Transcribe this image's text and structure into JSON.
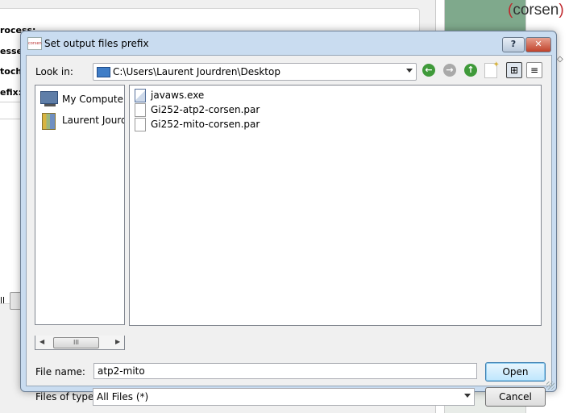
{
  "background": {
    "labels": [
      "rocess:",
      "esse",
      "toch",
      "efix:"
    ],
    "button_text": "ll",
    "logo_open": "(",
    "logo_text": "corsen",
    "logo_close": ")",
    "tiny_text": "◇"
  },
  "dialog": {
    "title": "Set output files prefix",
    "icon_text": "corsen",
    "help_label": "?",
    "close_label": "✕",
    "look_in": {
      "label": "Look in:",
      "value": "C:\\Users\\Laurent Jourdren\\Desktop"
    },
    "nav": {
      "back": "←",
      "forward": "→",
      "up": "↑",
      "list_view": "⊞",
      "details_view": "≡"
    },
    "places": [
      {
        "label": "My Computer",
        "icon": "computer-icon"
      },
      {
        "label": "Laurent Jourd",
        "icon": "user-folder-icon"
      }
    ],
    "scroll_thumb": "III",
    "scroll_left": "◀",
    "scroll_right": "▶",
    "files": [
      {
        "label": "javaws.exe",
        "icon": "executable-icon"
      },
      {
        "label": "Gi252-atp2-corsen.par",
        "icon": "file-icon"
      },
      {
        "label": "Gi252-mito-corsen.par",
        "icon": "file-icon"
      }
    ],
    "file_name": {
      "label": "File name:",
      "value": "atp2-mito"
    },
    "file_type": {
      "label": "Files of type:",
      "value": "All Files (*)"
    },
    "open_label": "Open",
    "cancel_label": "Cancel"
  }
}
